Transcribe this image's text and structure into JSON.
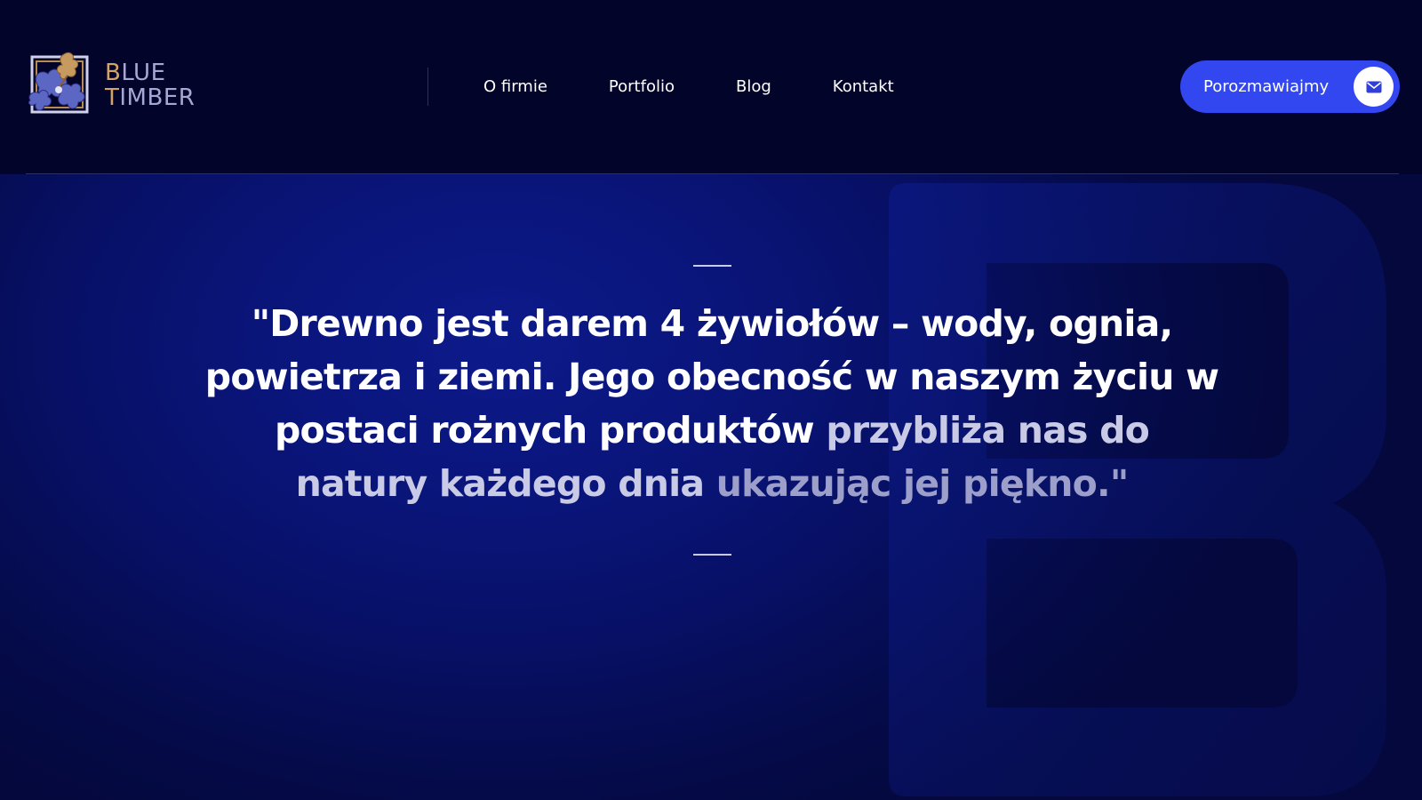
{
  "brand": {
    "line1_accent": "B",
    "line1_rest": "LUE",
    "line2_accent": "T",
    "line2_rest": "IMBER",
    "logo_icon": "oak-leaves-logo-icon",
    "accent_color": "#d2a468",
    "secondary_color": "#a4a8d4"
  },
  "nav": {
    "items": [
      {
        "label": "O firmie"
      },
      {
        "label": "Portfolio"
      },
      {
        "label": "Blog"
      },
      {
        "label": "Kontakt"
      }
    ]
  },
  "cta": {
    "label": "Porozmawiajmy",
    "icon": "envelope-icon",
    "color": "#3347f0"
  },
  "hero": {
    "quote_part1": "\"Drewno jest darem 4 żywiołów – wody, ognia, powietrza i ziemi. Jego obecność w naszym życiu w postaci rożnych produktów",
    "quote_part2": " przybliża nas do natury każdego dnia",
    "quote_part3": " ukazując jej piękno.\"",
    "background_color": "#0a157a"
  }
}
